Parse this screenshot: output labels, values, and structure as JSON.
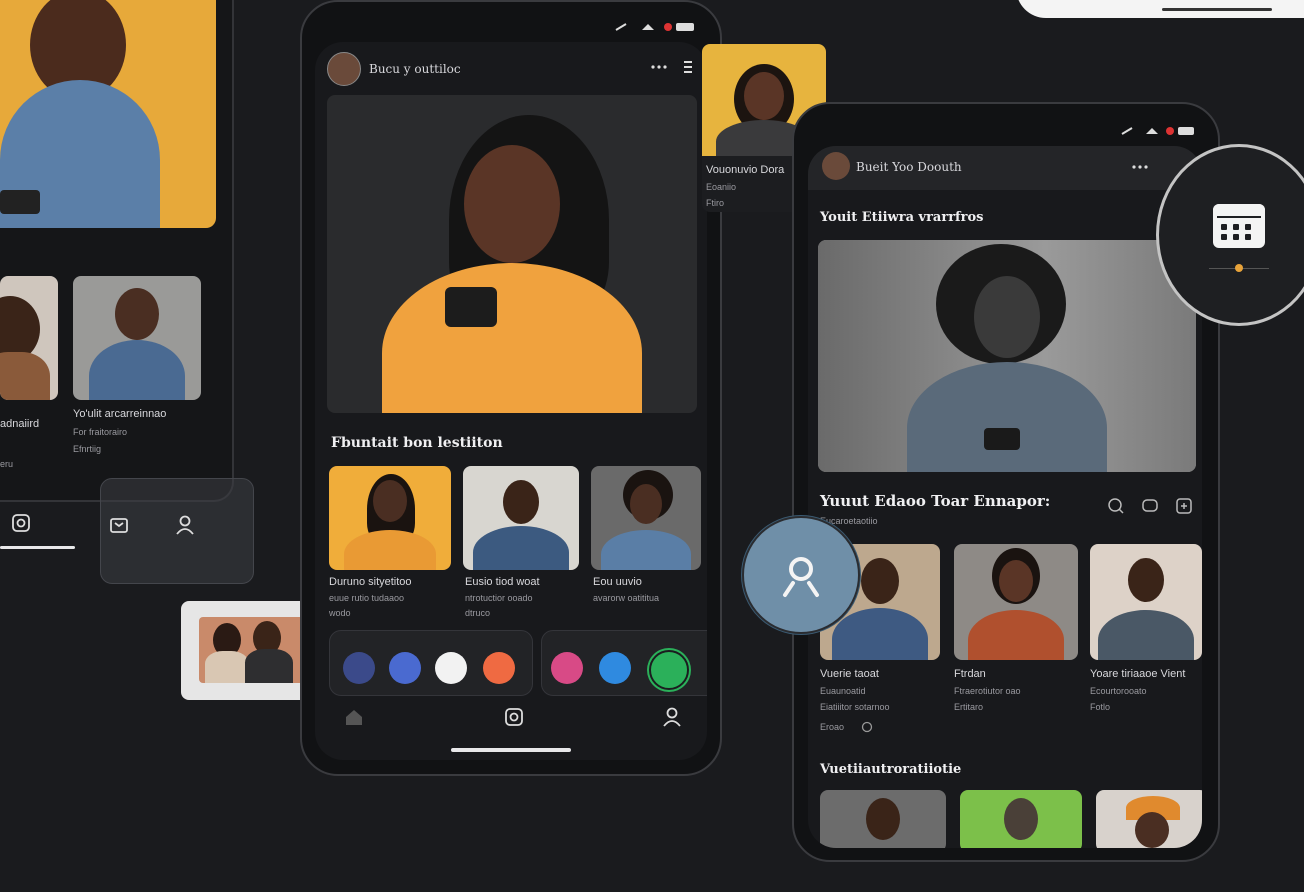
{
  "left_phone": {
    "card_title": "Yo'ulit arcarreinnao",
    "card_sub1": "For fraitorairo",
    "card_sub2": "Efnrtiig",
    "left_sub1": "adnaiird",
    "left_sub2": "eru"
  },
  "center_phone": {
    "header_title": "Bucu y outtiloc",
    "section_title": "Fbuntait bon lestiiton",
    "thumbs": [
      {
        "title": "Duruno sityetitoo",
        "sub1": "euue rutio tudaaoo",
        "sub2": "wodo"
      },
      {
        "title": "Eusio tiod woat",
        "sub1": "ntrotuctior ooado",
        "sub2": "dtruco"
      },
      {
        "title": "Eou uuvio",
        "sub1": "avarorw oatititua",
        "sub2": ""
      }
    ]
  },
  "popup_card": {
    "title": "Vouonuvio Dora",
    "sub1": "Eoaniio",
    "sub2": "Ftiro"
  },
  "right_phone": {
    "header_title": "Bueit Yoo Doouth",
    "section_title": "Youit Etiiwra vrarrfros",
    "feed_title": "Yuuut Edaoo Toar Ennapor:",
    "feed_sub": "Eucaroetaotiio",
    "people": [
      {
        "title": "Vuerie taoat",
        "sub1": "Euaunoatid",
        "sub2": "Eiatiiitor sotarnoo"
      },
      {
        "title": "Ftrdan",
        "sub1": "Ftraerotiutor oao",
        "sub2": "Ertitaro"
      },
      {
        "title": "Yoare tiriaaoe Vient",
        "sub1": "Ecourtorooato",
        "sub2": "Fotlo"
      }
    ],
    "meta": "Eroao",
    "bottom_section": "Vuetiiautroratiiotie"
  }
}
